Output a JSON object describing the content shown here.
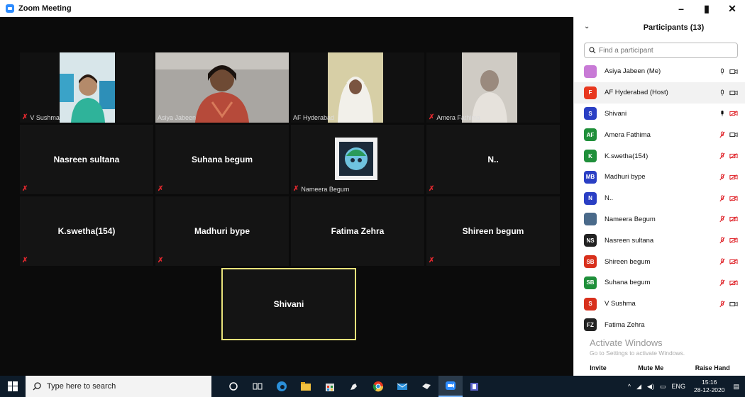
{
  "window": {
    "title": "Zoom Meeting",
    "controls": [
      "–",
      "▮",
      "✕"
    ]
  },
  "grid": {
    "row1": [
      {
        "name": "V Sushma",
        "muted": true
      },
      {
        "name": "Asiya Jabeen",
        "muted": false
      },
      {
        "name": "AF Hyderabad",
        "muted": false
      },
      {
        "name": "Amera Fathima",
        "muted": true
      }
    ],
    "row2": [
      {
        "name": "Nasreen sultana"
      },
      {
        "name": "Suhana begum"
      },
      {
        "name": "Nameera Begum"
      },
      {
        "name": "N.."
      }
    ],
    "row3": [
      {
        "name": "K.swetha(154)"
      },
      {
        "name": "Madhuri bype"
      },
      {
        "name": "Fatima Zehra"
      },
      {
        "name": "Shireen begum"
      }
    ],
    "row4": [
      {
        "name": "Shivani"
      }
    ]
  },
  "participants_panel": {
    "title": "Participants (13)",
    "search_placeholder": "Find a participant",
    "list": [
      {
        "name": "Asiya Jabeen (Me)",
        "initials": "",
        "color": "#c87ad6",
        "mic": "on",
        "cam": "on"
      },
      {
        "name": "AF Hyderabad (Host)",
        "initials": "F",
        "color": "#e8381f",
        "mic": "on",
        "cam": "on"
      },
      {
        "name": "Shivani",
        "initials": "S",
        "color": "#2a3fc4",
        "mic": "active",
        "cam": "off"
      },
      {
        "name": "Amera Fathima",
        "initials": "AF",
        "color": "#1f8f3a",
        "mic": "off",
        "cam": "on"
      },
      {
        "name": "K.swetha(154)",
        "initials": "K",
        "color": "#1f8f3a",
        "mic": "off",
        "cam": "off"
      },
      {
        "name": "Madhuri bype",
        "initials": "MB",
        "color": "#2a3fc4",
        "mic": "off",
        "cam": "off"
      },
      {
        "name": "N..",
        "initials": "N",
        "color": "#2a3fc4",
        "mic": "off",
        "cam": "off"
      },
      {
        "name": "Nameera Begum",
        "initials": "",
        "color": "#4a6a8a",
        "mic": "off",
        "cam": "off"
      },
      {
        "name": "Nasreen sultana",
        "initials": "NS",
        "color": "#222222",
        "mic": "off",
        "cam": "off"
      },
      {
        "name": "Shireen begum",
        "initials": "SB",
        "color": "#d8301c",
        "mic": "off",
        "cam": "off"
      },
      {
        "name": "Suhana begum",
        "initials": "SB",
        "color": "#1f8f3a",
        "mic": "off",
        "cam": "off"
      },
      {
        "name": "V Sushma",
        "initials": "S",
        "color": "#d8301c",
        "mic": "off",
        "cam": "on"
      },
      {
        "name": "Fatima Zehra",
        "initials": "FZ",
        "color": "#222222",
        "mic": "none",
        "cam": "none"
      }
    ],
    "watermark_title": "Activate Windows",
    "watermark_sub": "Go to Settings to activate Windows.",
    "footer": {
      "invite": "Invite",
      "mute_me": "Mute Me",
      "raise_hand": "Raise Hand"
    }
  },
  "taskbar": {
    "search_text": "Type here to search",
    "lang": "ENG",
    "time": "15:16",
    "date": "28-12-2020"
  }
}
